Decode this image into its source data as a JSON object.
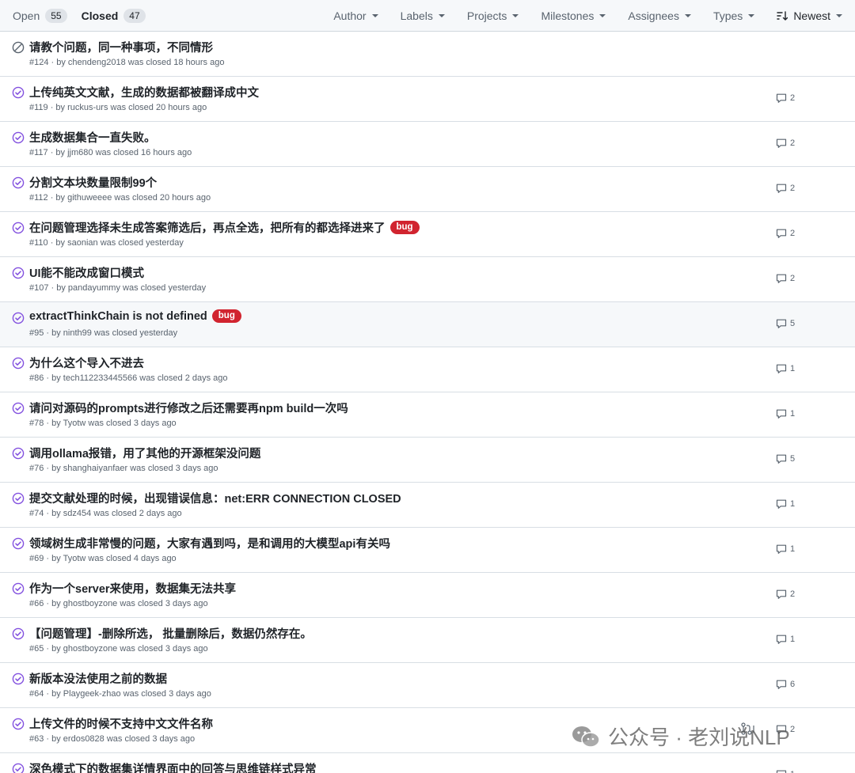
{
  "header": {
    "open_label": "Open",
    "open_count": "55",
    "closed_label": "Closed",
    "closed_count": "47",
    "filters": [
      "Author",
      "Labels",
      "Projects",
      "Milestones",
      "Assignees",
      "Types"
    ],
    "sort_label": "Newest"
  },
  "issues": [
    {
      "title": "请教个问题，同一种事项，不同情形",
      "meta": "#124 · by chendeng2018 was closed 18 hours ago",
      "comments": "",
      "label": "",
      "status": "not-planned"
    },
    {
      "title": "上传纯英文文献，生成的数据都被翻译成中文",
      "meta": "#119 · by ruckus-urs was closed 20 hours ago",
      "comments": "2",
      "label": "",
      "status": "completed"
    },
    {
      "title": "生成数据集合一直失败。",
      "meta": "#117 · by jjm680 was closed 16 hours ago",
      "comments": "2",
      "label": "",
      "status": "completed"
    },
    {
      "title": "分割文本块数量限制99个",
      "meta": "#112 · by githuweeee was closed 20 hours ago",
      "comments": "2",
      "label": "",
      "status": "completed"
    },
    {
      "title": "在问题管理选择未生成答案筛选后，再点全选，把所有的都选择进来了",
      "meta": "#110 · by saonian was closed yesterday",
      "comments": "2",
      "label": "bug",
      "status": "completed"
    },
    {
      "title": "UI能不能改成窗口模式",
      "meta": "#107 · by pandayummy was closed yesterday",
      "comments": "2",
      "label": "",
      "status": "completed"
    },
    {
      "title": "extractThinkChain is not defined",
      "meta": "#95 · by ninth99 was closed yesterday",
      "comments": "5",
      "label": "bug",
      "status": "completed"
    },
    {
      "title": "为什么这个导入不进去",
      "meta": "#86 · by tech112233445566 was closed 2 days ago",
      "comments": "1",
      "label": "",
      "status": "completed"
    },
    {
      "title": "请问对源码的prompts进行修改之后还需要再npm build一次吗",
      "meta": "#78 · by Tyotw was closed 3 days ago",
      "comments": "1",
      "label": "",
      "status": "completed"
    },
    {
      "title": "调用ollama报错，用了其他的开源框架没问题",
      "meta": "#76 · by shanghaiyanfaer was closed 3 days ago",
      "comments": "5",
      "label": "",
      "status": "completed"
    },
    {
      "title": "提交文献处理的时候，出现错误信息：net:ERR CONNECTION CLOSED",
      "meta": "#74 · by sdz454 was closed 2 days ago",
      "comments": "1",
      "label": "",
      "status": "completed"
    },
    {
      "title": "领域树生成非常慢的问题，大家有遇到吗，是和调用的大模型api有关吗",
      "meta": "#69 · by Tyotw was closed 4 days ago",
      "comments": "1",
      "label": "",
      "status": "completed"
    },
    {
      "title": "作为一个server来使用，数据集无法共享",
      "meta": "#66 · by ghostboyzone was closed 3 days ago",
      "comments": "2",
      "label": "",
      "status": "completed"
    },
    {
      "title": "【问题管理】-删除所选， 批量删除后，数据仍然存在。",
      "meta": "#65 · by ghostboyzone was closed 3 days ago",
      "comments": "1",
      "label": "",
      "status": "completed"
    },
    {
      "title": "新版本没法使用之前的数据",
      "meta": "#64 · by Playgeek-zhao was closed 3 days ago",
      "comments": "6",
      "label": "",
      "status": "completed"
    },
    {
      "title": "上传文件的时候不支持中文文件名称",
      "meta": "#63 · by erdos0828 was closed 3 days ago",
      "comments": "2",
      "label": "",
      "status": "completed"
    },
    {
      "title": "深色模式下的数据集详情界面中的回答与思维链样式异常",
      "meta": "",
      "comments": "1",
      "label": "",
      "status": "completed"
    }
  ],
  "watermark": "公众号 · 老刘说NLP",
  "colors": {
    "completed": "#8250df",
    "not_planned": "#59636e",
    "bug": "#d1242f",
    "header_bg": "#f6f8fa"
  }
}
